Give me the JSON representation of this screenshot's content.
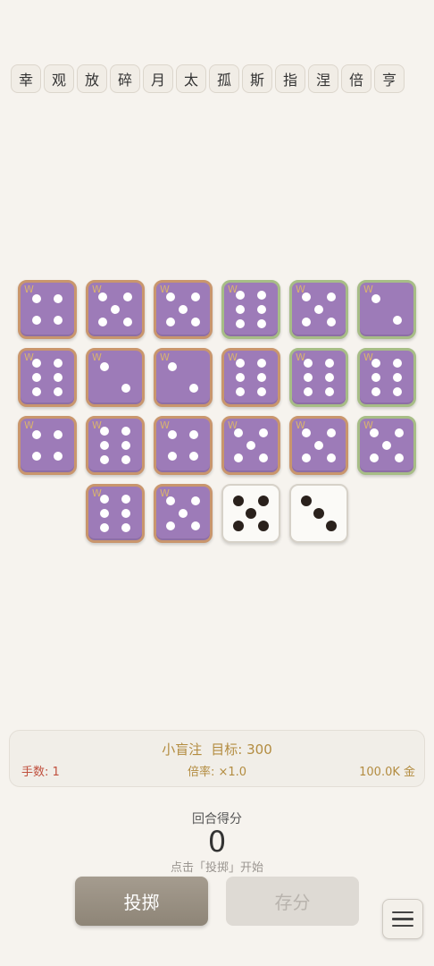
{
  "tags": [
    "幸",
    "观",
    "放",
    "碎",
    "月",
    "太",
    "孤",
    "斯",
    "指",
    "涅",
    "倍",
    "亨"
  ],
  "dice": [
    {
      "row": 0,
      "col": 0,
      "value": 4,
      "style": "purple",
      "border": "orange",
      "mark": "W"
    },
    {
      "row": 0,
      "col": 1,
      "value": 5,
      "style": "purple",
      "border": "orange",
      "mark": "W"
    },
    {
      "row": 0,
      "col": 2,
      "value": 5,
      "style": "purple",
      "border": "orange",
      "mark": "W"
    },
    {
      "row": 0,
      "col": 3,
      "value": 6,
      "style": "purple",
      "border": "green",
      "mark": "W"
    },
    {
      "row": 0,
      "col": 4,
      "value": 5,
      "style": "purple",
      "border": "green",
      "mark": "W"
    },
    {
      "row": 0,
      "col": 5,
      "value": 2,
      "style": "purple",
      "border": "green",
      "mark": "W"
    },
    {
      "row": 1,
      "col": 0,
      "value": 6,
      "style": "purple",
      "border": "orange",
      "mark": "W"
    },
    {
      "row": 1,
      "col": 1,
      "value": 2,
      "style": "purple",
      "border": "orange",
      "mark": "W"
    },
    {
      "row": 1,
      "col": 2,
      "value": 2,
      "style": "purple",
      "border": "orange",
      "mark": "W"
    },
    {
      "row": 1,
      "col": 3,
      "value": 6,
      "style": "purple",
      "border": "orange",
      "mark": "W"
    },
    {
      "row": 1,
      "col": 4,
      "value": 6,
      "style": "purple",
      "border": "green",
      "mark": "W"
    },
    {
      "row": 1,
      "col": 5,
      "value": 6,
      "style": "purple",
      "border": "green",
      "mark": "W"
    },
    {
      "row": 2,
      "col": 0,
      "value": 4,
      "style": "purple",
      "border": "orange",
      "mark": "W"
    },
    {
      "row": 2,
      "col": 1,
      "value": 6,
      "style": "purple",
      "border": "orange",
      "mark": "W"
    },
    {
      "row": 2,
      "col": 2,
      "value": 4,
      "style": "purple",
      "border": "orange",
      "mark": "W"
    },
    {
      "row": 2,
      "col": 3,
      "value": 5,
      "style": "purple",
      "border": "orange",
      "mark": "W"
    },
    {
      "row": 2,
      "col": 4,
      "value": 5,
      "style": "purple",
      "border": "orange",
      "mark": "W"
    },
    {
      "row": 2,
      "col": 5,
      "value": 5,
      "style": "purple",
      "border": "green",
      "mark": "W"
    },
    {
      "row": 3,
      "col": 1,
      "value": 6,
      "style": "purple",
      "border": "orange",
      "mark": "W"
    },
    {
      "row": 3,
      "col": 2,
      "value": 5,
      "style": "purple",
      "border": "orange",
      "mark": "W"
    },
    {
      "row": 3,
      "col": 3,
      "value": 5,
      "style": "white",
      "border": "none",
      "mark": ""
    },
    {
      "row": 3,
      "col": 4,
      "value": 3,
      "style": "white",
      "border": "none",
      "mark": ""
    }
  ],
  "info": {
    "blind": "小盲注",
    "target": "目标: 300",
    "hands": "手数: 1",
    "rate": "倍率: ×1.0",
    "gold": "100.0K 金"
  },
  "score": {
    "label": "回合得分",
    "value": "0",
    "hint": "点击「投掷」开始"
  },
  "buttons": {
    "roll": "投掷",
    "save": "存分"
  },
  "colors": {
    "die_purple": "#9d7bb8",
    "border_orange": "#c9966d",
    "border_green": "#a7bd86",
    "accent_gold": "#b38c40",
    "hands_red": "#c0503e"
  },
  "icons": {
    "menu": "hamburger-menu-icon"
  }
}
